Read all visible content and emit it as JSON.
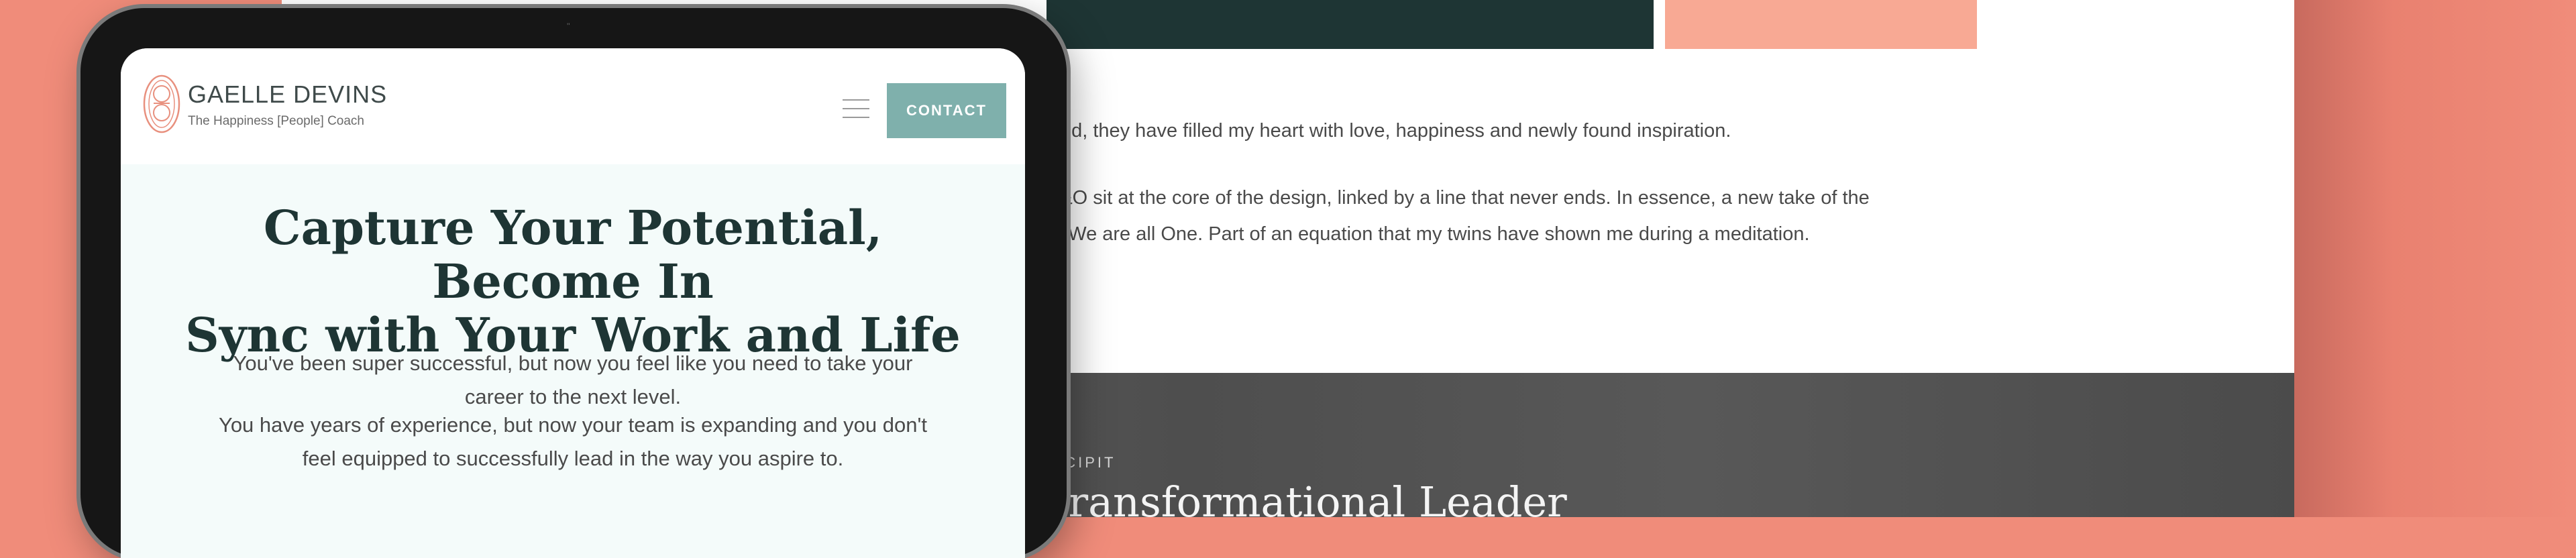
{
  "desktop": {
    "paragraph1": "ived, they have filled my heart with love, happiness and newly found inspiration.",
    "paragraph2_line1": "A&O sit at the core of the design, linked by a line that never ends. In essence, a new take of the",
    "paragraph2_line2": "nt We are all One. Part of an equation that my twins have shown me during a meditation.",
    "section_eyebrow": "SUSCIPIT",
    "section_heading": "rm into the Transformational Leader"
  },
  "tablet": {
    "brand": {
      "name": "GAELLE DEVINS",
      "tagline": "The Happiness [People] Coach",
      "logo_icon": "monogram-logo"
    },
    "nav": {
      "menu_icon": "hamburger-icon",
      "contact_label": "CONTACT"
    },
    "hero": {
      "title_line1": "Capture Your Potential, Become In",
      "title_line2": "Sync with Your Work and Life",
      "paragraph1_line1": "You've been super successful, but now you feel like you need to take your",
      "paragraph1_line2": "career to the next level.",
      "paragraph2_line1": "You have years of experience, but now your team is expanding and you don't",
      "paragraph2_line2": "feel equipped to successfully lead in the way you aspire to."
    }
  },
  "colors": {
    "background": "#f08c7a",
    "dark_teal": "#1e3534",
    "accent_teal": "#7fb0ac",
    "salmon": "#f8a994",
    "hero_bg": "#f4fbfa"
  }
}
